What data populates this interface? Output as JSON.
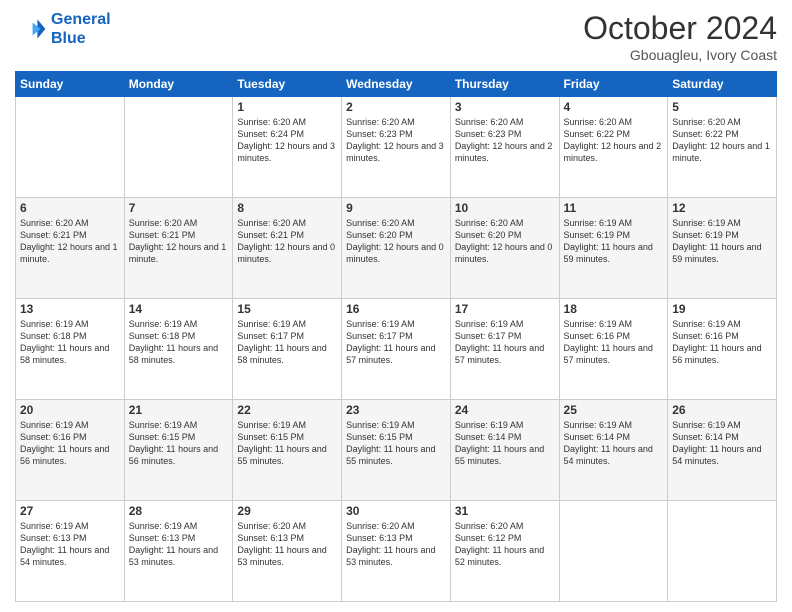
{
  "header": {
    "logo_line1": "General",
    "logo_line2": "Blue",
    "month": "October 2024",
    "location": "Gbouagleu, Ivory Coast"
  },
  "weekdays": [
    "Sunday",
    "Monday",
    "Tuesday",
    "Wednesday",
    "Thursday",
    "Friday",
    "Saturday"
  ],
  "weeks": [
    [
      {
        "day": "",
        "info": ""
      },
      {
        "day": "",
        "info": ""
      },
      {
        "day": "1",
        "info": "Sunrise: 6:20 AM\nSunset: 6:24 PM\nDaylight: 12 hours and 3 minutes."
      },
      {
        "day": "2",
        "info": "Sunrise: 6:20 AM\nSunset: 6:23 PM\nDaylight: 12 hours and 3 minutes."
      },
      {
        "day": "3",
        "info": "Sunrise: 6:20 AM\nSunset: 6:23 PM\nDaylight: 12 hours and 2 minutes."
      },
      {
        "day": "4",
        "info": "Sunrise: 6:20 AM\nSunset: 6:22 PM\nDaylight: 12 hours and 2 minutes."
      },
      {
        "day": "5",
        "info": "Sunrise: 6:20 AM\nSunset: 6:22 PM\nDaylight: 12 hours and 1 minute."
      }
    ],
    [
      {
        "day": "6",
        "info": "Sunrise: 6:20 AM\nSunset: 6:21 PM\nDaylight: 12 hours and 1 minute."
      },
      {
        "day": "7",
        "info": "Sunrise: 6:20 AM\nSunset: 6:21 PM\nDaylight: 12 hours and 1 minute."
      },
      {
        "day": "8",
        "info": "Sunrise: 6:20 AM\nSunset: 6:21 PM\nDaylight: 12 hours and 0 minutes."
      },
      {
        "day": "9",
        "info": "Sunrise: 6:20 AM\nSunset: 6:20 PM\nDaylight: 12 hours and 0 minutes."
      },
      {
        "day": "10",
        "info": "Sunrise: 6:20 AM\nSunset: 6:20 PM\nDaylight: 12 hours and 0 minutes."
      },
      {
        "day": "11",
        "info": "Sunrise: 6:19 AM\nSunset: 6:19 PM\nDaylight: 11 hours and 59 minutes."
      },
      {
        "day": "12",
        "info": "Sunrise: 6:19 AM\nSunset: 6:19 PM\nDaylight: 11 hours and 59 minutes."
      }
    ],
    [
      {
        "day": "13",
        "info": "Sunrise: 6:19 AM\nSunset: 6:18 PM\nDaylight: 11 hours and 58 minutes."
      },
      {
        "day": "14",
        "info": "Sunrise: 6:19 AM\nSunset: 6:18 PM\nDaylight: 11 hours and 58 minutes."
      },
      {
        "day": "15",
        "info": "Sunrise: 6:19 AM\nSunset: 6:17 PM\nDaylight: 11 hours and 58 minutes."
      },
      {
        "day": "16",
        "info": "Sunrise: 6:19 AM\nSunset: 6:17 PM\nDaylight: 11 hours and 57 minutes."
      },
      {
        "day": "17",
        "info": "Sunrise: 6:19 AM\nSunset: 6:17 PM\nDaylight: 11 hours and 57 minutes."
      },
      {
        "day": "18",
        "info": "Sunrise: 6:19 AM\nSunset: 6:16 PM\nDaylight: 11 hours and 57 minutes."
      },
      {
        "day": "19",
        "info": "Sunrise: 6:19 AM\nSunset: 6:16 PM\nDaylight: 11 hours and 56 minutes."
      }
    ],
    [
      {
        "day": "20",
        "info": "Sunrise: 6:19 AM\nSunset: 6:16 PM\nDaylight: 11 hours and 56 minutes."
      },
      {
        "day": "21",
        "info": "Sunrise: 6:19 AM\nSunset: 6:15 PM\nDaylight: 11 hours and 56 minutes."
      },
      {
        "day": "22",
        "info": "Sunrise: 6:19 AM\nSunset: 6:15 PM\nDaylight: 11 hours and 55 minutes."
      },
      {
        "day": "23",
        "info": "Sunrise: 6:19 AM\nSunset: 6:15 PM\nDaylight: 11 hours and 55 minutes."
      },
      {
        "day": "24",
        "info": "Sunrise: 6:19 AM\nSunset: 6:14 PM\nDaylight: 11 hours and 55 minutes."
      },
      {
        "day": "25",
        "info": "Sunrise: 6:19 AM\nSunset: 6:14 PM\nDaylight: 11 hours and 54 minutes."
      },
      {
        "day": "26",
        "info": "Sunrise: 6:19 AM\nSunset: 6:14 PM\nDaylight: 11 hours and 54 minutes."
      }
    ],
    [
      {
        "day": "27",
        "info": "Sunrise: 6:19 AM\nSunset: 6:13 PM\nDaylight: 11 hours and 54 minutes."
      },
      {
        "day": "28",
        "info": "Sunrise: 6:19 AM\nSunset: 6:13 PM\nDaylight: 11 hours and 53 minutes."
      },
      {
        "day": "29",
        "info": "Sunrise: 6:20 AM\nSunset: 6:13 PM\nDaylight: 11 hours and 53 minutes."
      },
      {
        "day": "30",
        "info": "Sunrise: 6:20 AM\nSunset: 6:13 PM\nDaylight: 11 hours and 53 minutes."
      },
      {
        "day": "31",
        "info": "Sunrise: 6:20 AM\nSunset: 6:12 PM\nDaylight: 11 hours and 52 minutes."
      },
      {
        "day": "",
        "info": ""
      },
      {
        "day": "",
        "info": ""
      }
    ]
  ]
}
